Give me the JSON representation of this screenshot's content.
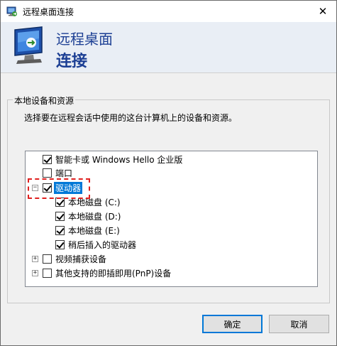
{
  "window": {
    "title": "远程桌面连接",
    "close_glyph": "✕"
  },
  "header": {
    "line1": "远程桌面",
    "line2": "连接"
  },
  "group": {
    "legend": "本地设备和资源",
    "description": "选择要在远程会话中使用的这台计算机上的设备和资源。"
  },
  "tree": {
    "items": [
      {
        "label": "智能卡或 Windows Hello 企业版",
        "checked": true
      },
      {
        "label": "端口",
        "checked": false
      },
      {
        "label": "驱动器",
        "checked": true,
        "selected": true,
        "expander": "−"
      },
      {
        "label": "本地磁盘 (C:)",
        "checked": true
      },
      {
        "label": "本地磁盘 (D:)",
        "checked": true
      },
      {
        "label": "本地磁盘 (E:)",
        "checked": true
      },
      {
        "label": "稍后插入的驱动器",
        "checked": true
      },
      {
        "label": "视频捕获设备",
        "checked": false,
        "expander": "+"
      },
      {
        "label": "其他支持的即插即用(PnP)设备",
        "checked": false,
        "expander": "+"
      }
    ]
  },
  "buttons": {
    "ok": "确定",
    "cancel": "取消"
  },
  "colors": {
    "accent": "#0078d7",
    "header_text": "#1c3f94",
    "annotation": "#e0201f"
  }
}
